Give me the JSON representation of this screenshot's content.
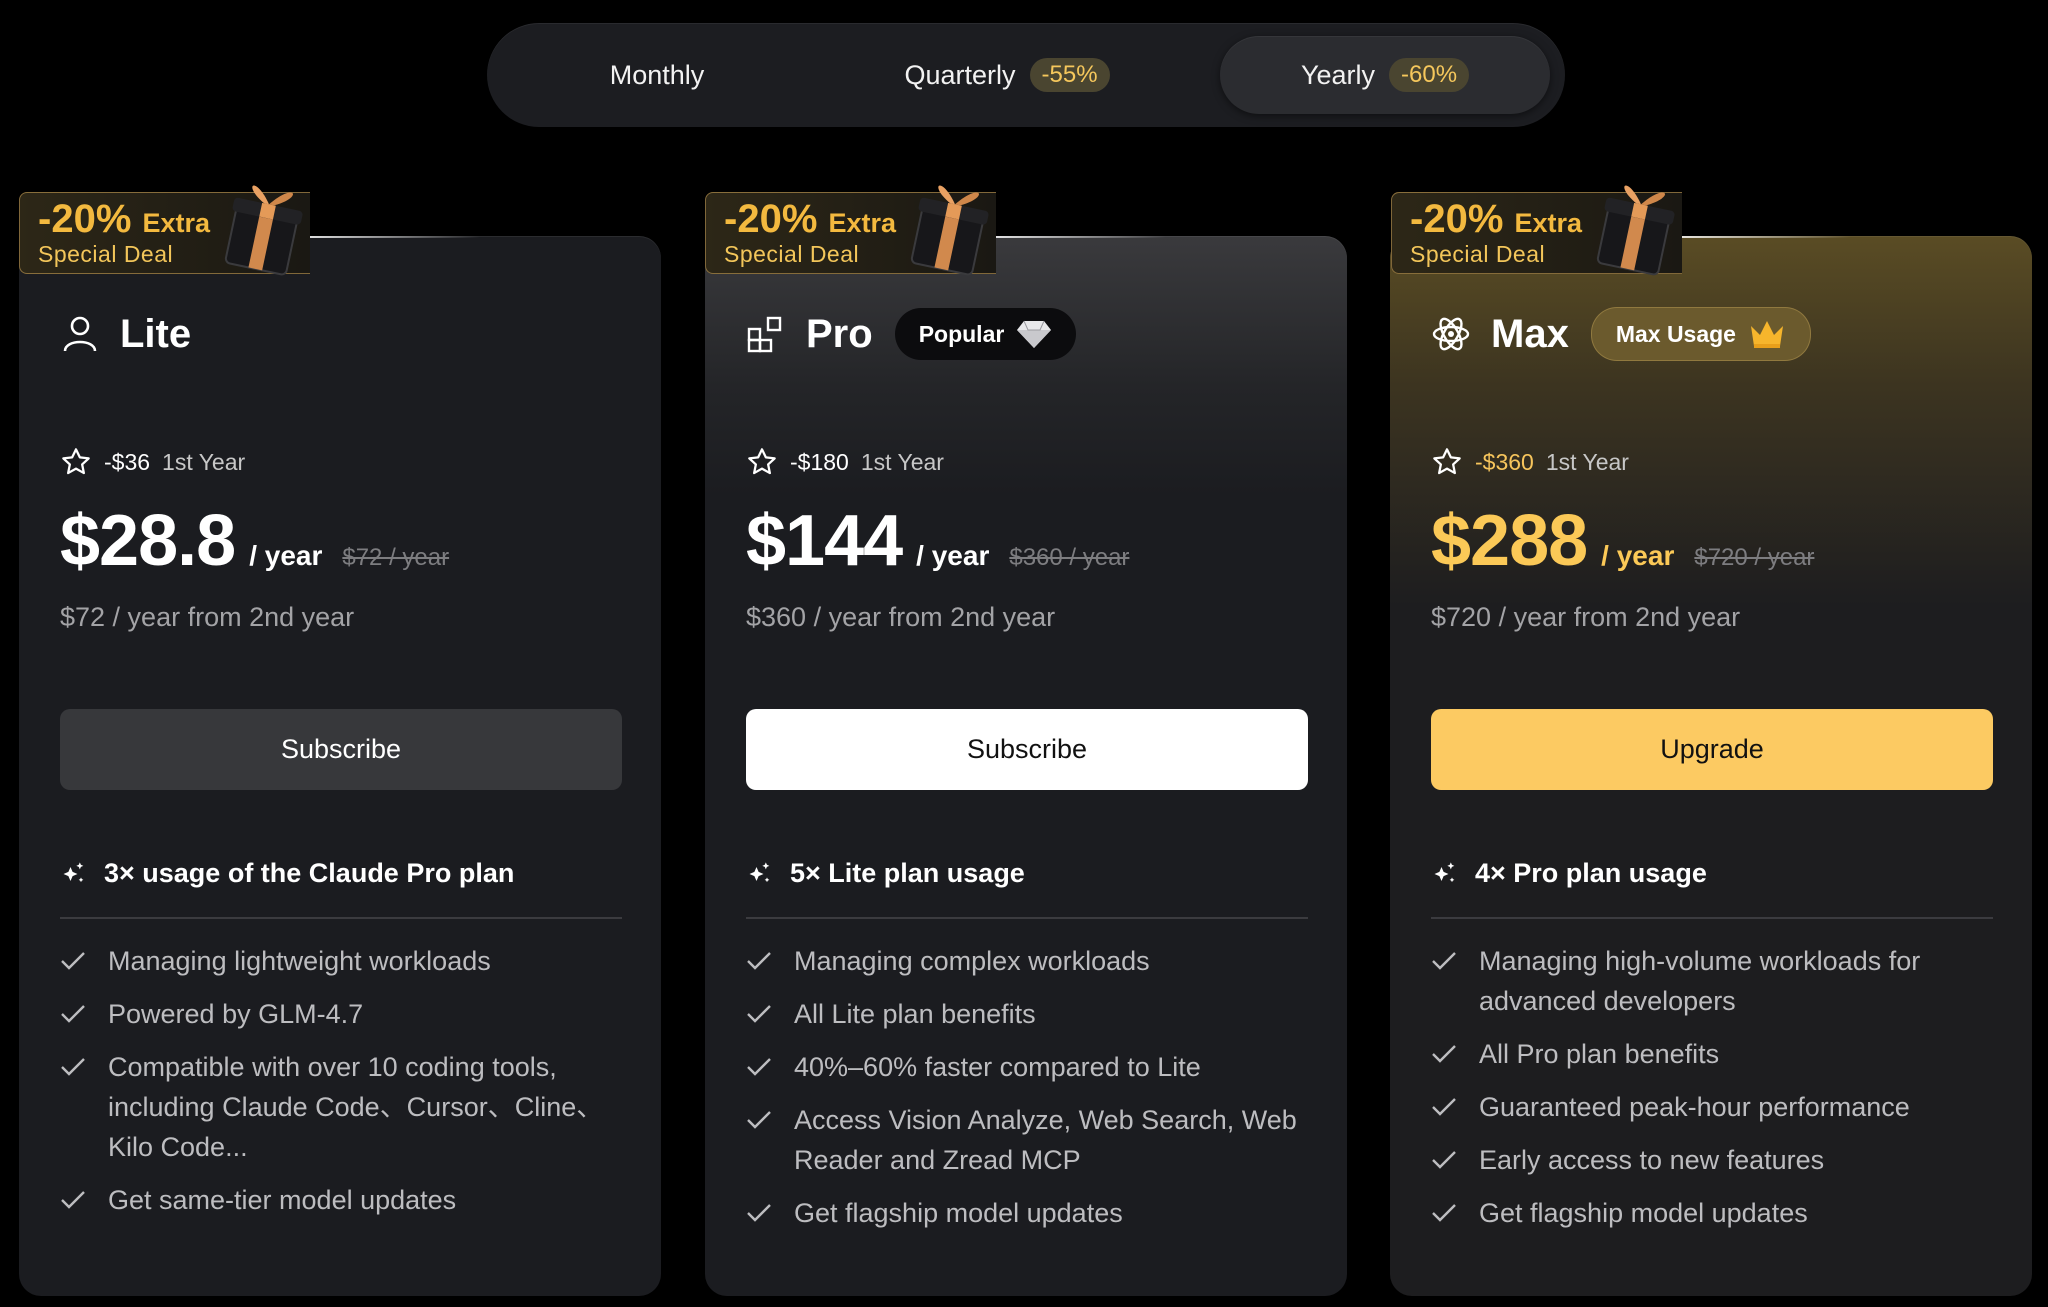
{
  "billing_toggle": {
    "options": [
      {
        "label": "Monthly",
        "discount": ""
      },
      {
        "label": "Quarterly",
        "discount": "-55%"
      },
      {
        "label": "Yearly",
        "discount": "-60%"
      }
    ],
    "selected": "Yearly"
  },
  "deal_badge": {
    "percent": "-20%",
    "extra": "Extra",
    "subtitle": "Special Deal",
    "icon": "gift-icon"
  },
  "plans": [
    {
      "name": "Lite",
      "icon": "user-icon",
      "tag": "",
      "tag_icon": "",
      "promo_amount": "-$36",
      "promo_suffix": "1st Year",
      "price": "$28.8",
      "per": "/ year",
      "old_price": "$72 / year",
      "second_year": "$72 / year from 2nd year",
      "button": "Subscribe",
      "feature_heading": "3× usage of the Claude Pro plan",
      "features": [
        "Managing lightweight workloads",
        "Powered by GLM-4.7",
        "Compatible with over 10 coding tools, including Claude Code、Cursor、Cline、Kilo Code...",
        "Get same-tier model updates"
      ]
    },
    {
      "name": "Pro",
      "icon": "blocks-icon",
      "tag": "Popular",
      "tag_icon": "diamond-icon",
      "promo_amount": "-$180",
      "promo_suffix": "1st Year",
      "price": "$144",
      "per": "/ year",
      "old_price": "$360 / year",
      "second_year": "$360 / year from 2nd year",
      "button": "Subscribe",
      "feature_heading": "5× Lite plan usage",
      "features": [
        "Managing complex workloads",
        "All Lite plan benefits",
        "40%–60% faster compared to Lite",
        "Access Vision Analyze, Web Search, Web Reader and Zread MCP",
        "Get flagship model updates"
      ]
    },
    {
      "name": "Max",
      "icon": "atom-icon",
      "tag": "Max Usage",
      "tag_icon": "crown-icon",
      "promo_amount": "-$360",
      "promo_suffix": "1st Year",
      "price": "$288",
      "per": "/ year",
      "old_price": "$720 / year",
      "second_year": "$720 / year from 2nd year",
      "button": "Upgrade",
      "feature_heading": "4× Pro plan usage",
      "features": [
        "Managing high-volume workloads for advanced developers",
        "All Pro plan benefits",
        "Guaranteed peak-hour performance",
        "Early access to new features",
        "Get flagship model updates"
      ]
    }
  ],
  "colors": {
    "accent_gold": "#fbc957",
    "deal_orange": "#f3b93f",
    "background": "#000000",
    "card": "#1b1c20"
  }
}
